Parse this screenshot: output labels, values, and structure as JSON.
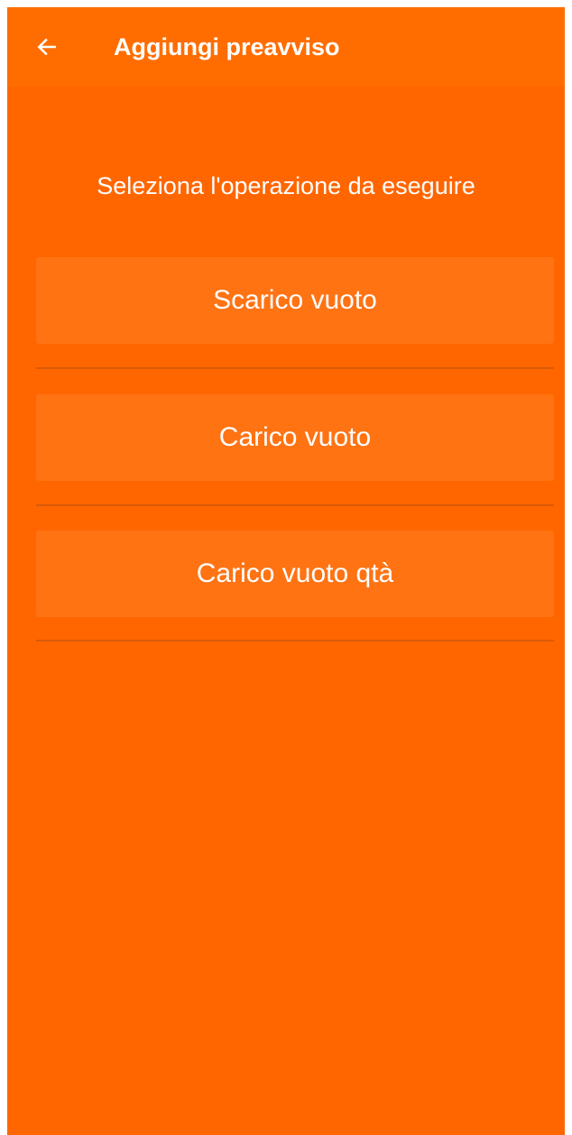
{
  "app_bar": {
    "back_icon": "arrow-left-icon",
    "title": "Aggiungi preavviso"
  },
  "main": {
    "subtitle": "Seleziona l'operazione da eseguire",
    "options": [
      {
        "label": "Scarico vuoto"
      },
      {
        "label": "Carico vuoto"
      },
      {
        "label": "Carico vuoto qtà"
      }
    ]
  },
  "colors": {
    "background": "#ff6600",
    "app_bar": "#ff6d00",
    "option_background": "#ff7313",
    "divider": "#d95a08",
    "text": "#ffffff"
  }
}
